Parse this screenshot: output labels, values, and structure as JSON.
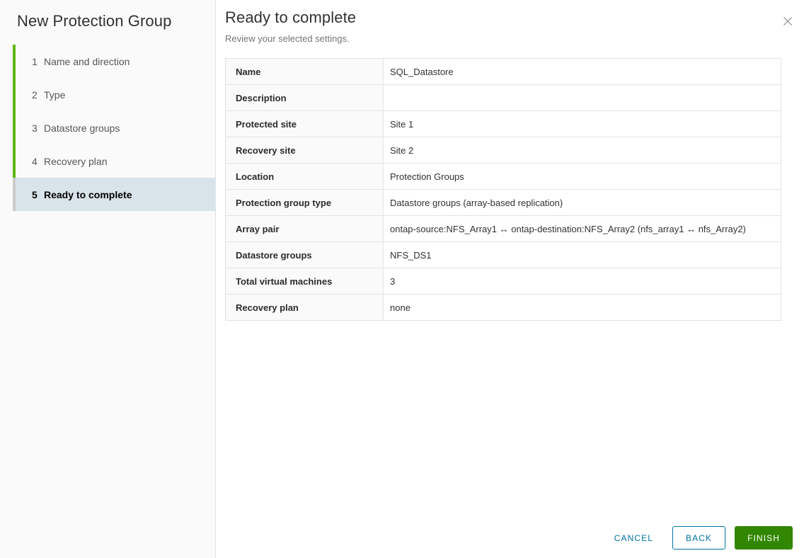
{
  "wizard": {
    "title": "New Protection Group"
  },
  "sidebar": {
    "steps": [
      {
        "num": "1",
        "label": "Name and direction",
        "state": "complete"
      },
      {
        "num": "2",
        "label": "Type",
        "state": "complete"
      },
      {
        "num": "3",
        "label": "Datastore groups",
        "state": "complete"
      },
      {
        "num": "4",
        "label": "Recovery plan",
        "state": "complete"
      },
      {
        "num": "5",
        "label": "Ready to complete",
        "state": "active"
      }
    ]
  },
  "header": {
    "title": "Ready to complete",
    "subtitle": "Review your selected settings.",
    "close_icon": "close-icon"
  },
  "summary": {
    "rows": [
      {
        "label": "Name",
        "value": "SQL_Datastore"
      },
      {
        "label": "Description",
        "value": ""
      },
      {
        "label": "Protected site",
        "value": "Site 1"
      },
      {
        "label": "Recovery site",
        "value": "Site 2"
      },
      {
        "label": "Location",
        "value": "Protection Groups"
      },
      {
        "label": "Protection group type",
        "value": "Datastore groups (array-based replication)"
      },
      {
        "label": "Array pair",
        "value": "ontap-source:NFS_Array1 ↔ ontap-destination:NFS_Array2 (nfs_array1 ↔ nfs_Array2)"
      },
      {
        "label": "Datastore groups",
        "value": "NFS_DS1"
      },
      {
        "label": "Total virtual machines",
        "value": "3"
      },
      {
        "label": "Recovery plan",
        "value": "none"
      }
    ]
  },
  "footer": {
    "cancel_label": "Cancel",
    "back_label": "Back",
    "finish_label": "Finish"
  },
  "colors": {
    "step_complete": "#60b515",
    "step_pending": "#cccccc",
    "active_step_bg": "#d9e4ea",
    "link": "#0072a3",
    "primary_action": "#318700",
    "sidebar_bg": "#fafafa",
    "border": "#e3e3e3"
  }
}
